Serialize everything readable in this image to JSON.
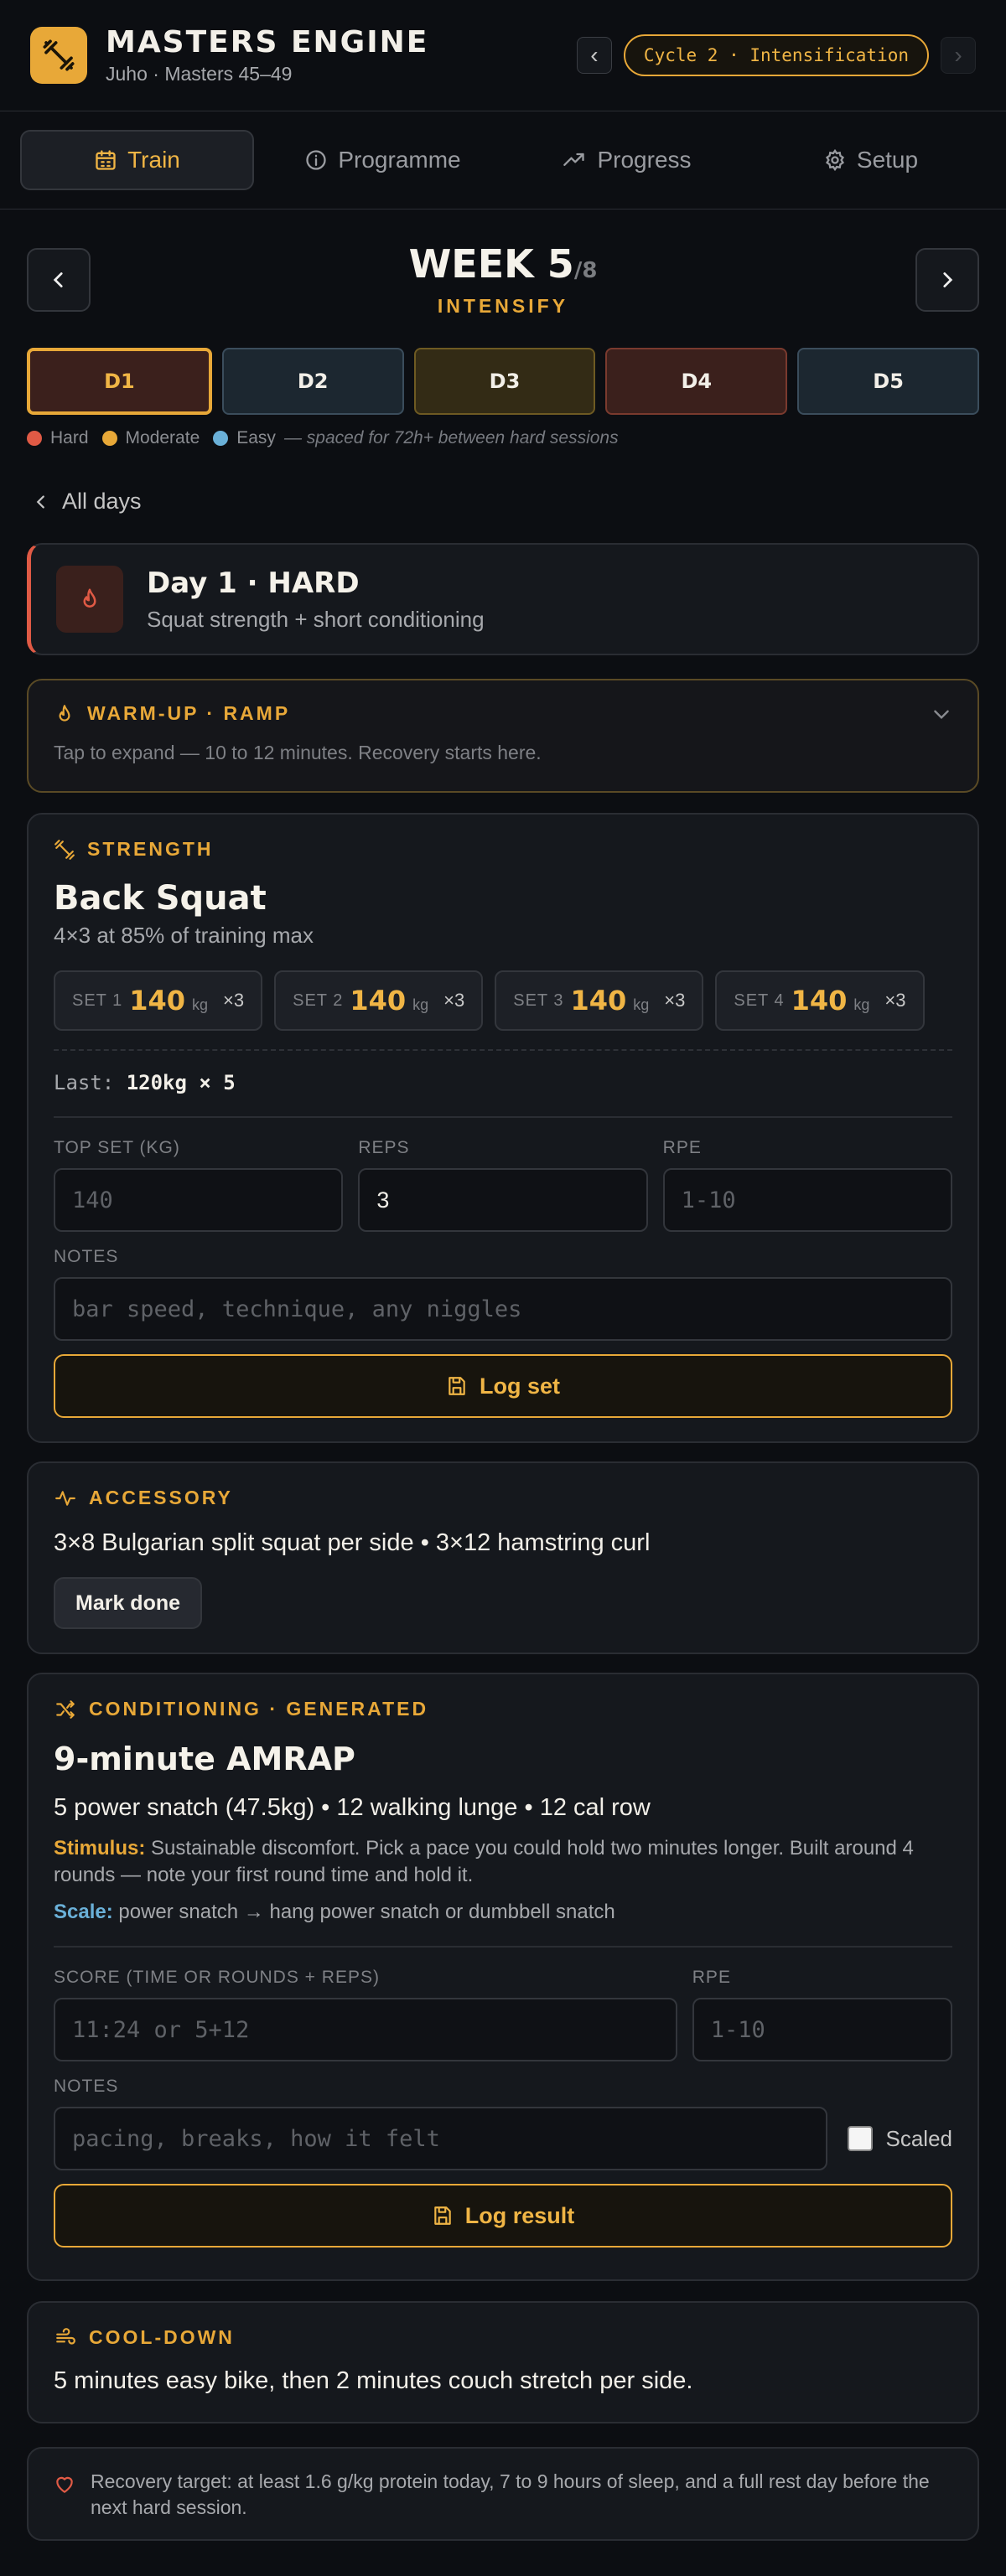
{
  "header": {
    "app_title": "MASTERS ENGINE",
    "subtitle": "Juho · Masters 45–49",
    "cycle_prev": "‹",
    "cycle_label": "Cycle 2 · Intensification",
    "cycle_next": "›",
    "accent": "#e8a838"
  },
  "tabs": [
    {
      "label": "Train",
      "icon": "calendar-icon",
      "active": true
    },
    {
      "label": "Programme",
      "icon": "info-icon"
    },
    {
      "label": "Progress",
      "icon": "trending-up-icon"
    },
    {
      "label": "Setup",
      "icon": "gear-icon"
    }
  ],
  "week": {
    "title": "WEEK 5",
    "of": "/8",
    "phase": "INTENSIFY"
  },
  "days": [
    {
      "label": "D1",
      "intensity": "hard",
      "active": true
    },
    {
      "label": "D2",
      "intensity": "easy"
    },
    {
      "label": "D3",
      "intensity": "moderate"
    },
    {
      "label": "D4",
      "intensity": "hard"
    },
    {
      "label": "D5",
      "intensity": "easy"
    }
  ],
  "legend": {
    "hard": "Hard",
    "moderate": "Moderate",
    "easy": "Easy",
    "note": "— spaced for 72h+ between hard sessions",
    "colors": {
      "hard": "#e05a45",
      "moderate": "#e8a838",
      "easy": "#6ab0d8"
    }
  },
  "back_link": "All days",
  "day_card": {
    "title": "Day 1 · HARD",
    "subtitle": "Squat strength + short conditioning"
  },
  "warmup": {
    "heading": "WARM-UP · RAMP",
    "text": "Tap to expand — 10 to 12 minutes. Recovery starts here."
  },
  "strength": {
    "heading": "STRENGTH",
    "exercise": "Back Squat",
    "prescription": "4×3 at 85% of training max",
    "sets": [
      {
        "label": "SET 1",
        "weight": "140",
        "unit": "kg",
        "reps": "×3"
      },
      {
        "label": "SET 2",
        "weight": "140",
        "unit": "kg",
        "reps": "×3"
      },
      {
        "label": "SET 3",
        "weight": "140",
        "unit": "kg",
        "reps": "×3"
      },
      {
        "label": "SET 4",
        "weight": "140",
        "unit": "kg",
        "reps": "×3"
      }
    ],
    "last_label": "Last:",
    "last_value": "120kg × 5",
    "top_set_label": "TOP SET (KG)",
    "top_set_placeholder": "140",
    "reps_label": "REPS",
    "reps_value": "3",
    "rpe_label": "RPE",
    "rpe_placeholder": "1-10",
    "notes_label": "NOTES",
    "notes_placeholder": "bar speed, technique, any niggles",
    "log_button": "Log set"
  },
  "accessory": {
    "heading": "ACCESSORY",
    "text": "3×8 Bulgarian split squat per side • 3×12 hamstring curl",
    "button": "Mark done"
  },
  "conditioning": {
    "heading": "CONDITIONING · GENERATED",
    "title": "9-minute AMRAP",
    "description": "5 power snatch (47.5kg) • 12 walking lunge • 12 cal row",
    "stimulus_label": "Stimulus:",
    "stimulus_text": "Sustainable discomfort. Pick a pace you could hold two minutes longer. Built around 4 rounds — note your first round time and hold it.",
    "scale_label": "Scale:",
    "scale_text": "power snatch → hang power snatch or dumbbell snatch",
    "score_label": "SCORE (TIME OR ROUNDS + REPS)",
    "score_placeholder": "11:24 or 5+12",
    "rpe_label": "RPE",
    "rpe_placeholder": "1-10",
    "notes_label": "NOTES",
    "notes_placeholder": "pacing, breaks, how it felt",
    "scaled_label": "Scaled",
    "log_button": "Log result"
  },
  "cooldown": {
    "heading": "COOL-DOWN",
    "text": "5 minutes easy bike, then 2 minutes couch stretch per side."
  },
  "recovery": {
    "text": "Recovery target: at least 1.6 g/kg protein today, 7 to 9 hours of sleep, and a full rest day before the next hard session."
  }
}
